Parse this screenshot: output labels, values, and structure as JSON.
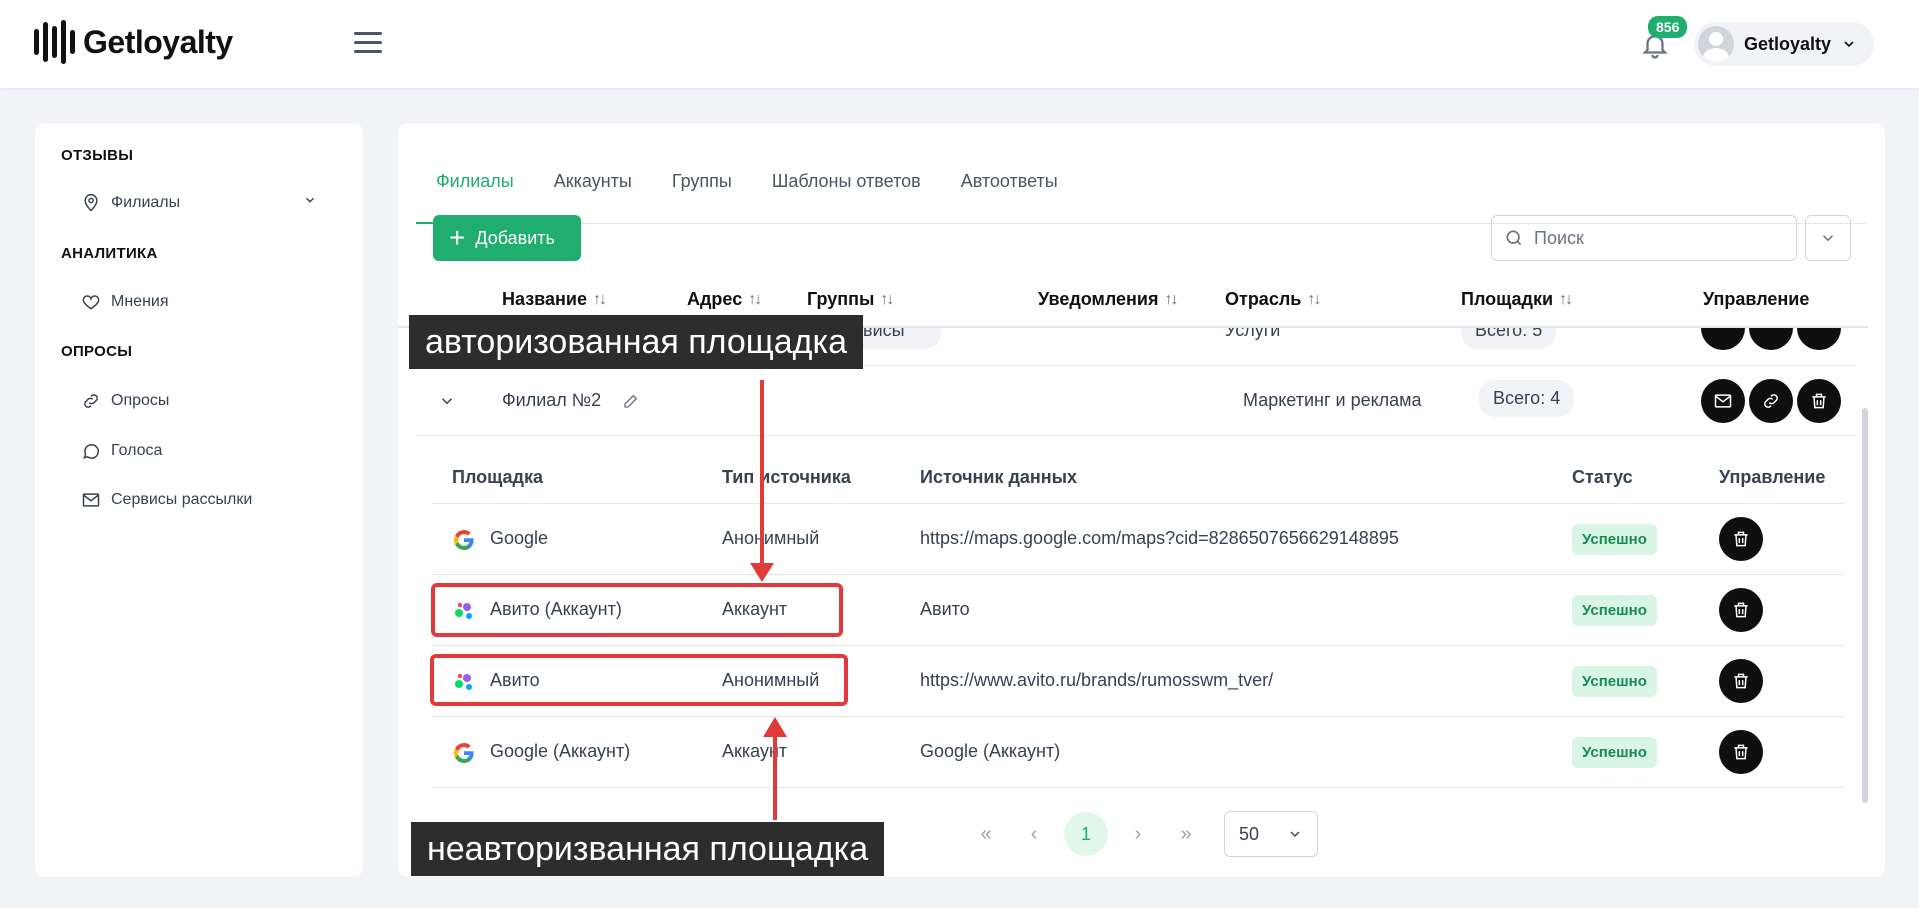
{
  "header": {
    "logo_text": "Getloyalty",
    "notification_count": "856",
    "user_name": "Getloyalty"
  },
  "sidebar": {
    "sections": [
      {
        "title": "ОТЗЫВЫ",
        "items": [
          {
            "label": "Филиалы",
            "icon": "map-pin-icon"
          }
        ]
      },
      {
        "title": "АНАЛИТИКА",
        "items": [
          {
            "label": "Мнения",
            "icon": "heart-icon"
          }
        ]
      },
      {
        "title": "ОПРОСЫ",
        "items": [
          {
            "label": "Опросы",
            "icon": "link-icon"
          },
          {
            "label": "Голоса",
            "icon": "chat-icon"
          },
          {
            "label": "Сервисы рассылки",
            "icon": "mail-icon"
          }
        ]
      }
    ]
  },
  "tabs": [
    {
      "label": "Филиалы",
      "active": true
    },
    {
      "label": "Аккаунты",
      "active": false
    },
    {
      "label": "Группы",
      "active": false
    },
    {
      "label": "Шаблоны ответов",
      "active": false
    },
    {
      "label": "Автоответы",
      "active": false
    }
  ],
  "toolbar": {
    "add_label": "Добавить",
    "search_placeholder": "Поиск"
  },
  "table": {
    "columns": [
      "Название",
      "Адрес",
      "Группы",
      "Уведомления",
      "Отрасль",
      "Площадки",
      "Управление"
    ],
    "partial_row": {
      "groups": "Сервисы",
      "industry": "Услуги",
      "platforms": "Всего: 5"
    },
    "row": {
      "name": "Филиал №2",
      "industry": "Маркетинг и реклама",
      "platforms": "Всего: 4"
    }
  },
  "subtable": {
    "columns": [
      "Площадка",
      "Тип источника",
      "Источник данных",
      "Статус",
      "Управление"
    ],
    "rows": [
      {
        "platform": "Google",
        "icon": "google-icon",
        "type": "Анонимный",
        "source": "https://maps.google.com/maps?cid=8286507656629148895",
        "status": "Успешно"
      },
      {
        "platform": "Авито (Аккаунт)",
        "icon": "avito-icon",
        "type": "Аккаунт",
        "source": "Авито",
        "status": "Успешно"
      },
      {
        "platform": "Авито",
        "icon": "avito-icon",
        "type": "Анонимный",
        "source": "https://www.avito.ru/brands/rumosswm_tver/",
        "status": "Успешно"
      },
      {
        "platform": "Google (Аккаунт)",
        "icon": "google-icon",
        "type": "Аккаунт",
        "source": "Google (Аккаунт)",
        "status": "Успешно"
      }
    ]
  },
  "pagination": {
    "first": "«",
    "prev": "‹",
    "current": "1",
    "next": "›",
    "last": "»",
    "per_page": "50"
  },
  "annotations": {
    "top": "авторизованная площадка",
    "bottom": "неавторизванная площадка"
  },
  "colors": {
    "accent": "#1fae6f",
    "annotation_red": "#e03a3a"
  }
}
